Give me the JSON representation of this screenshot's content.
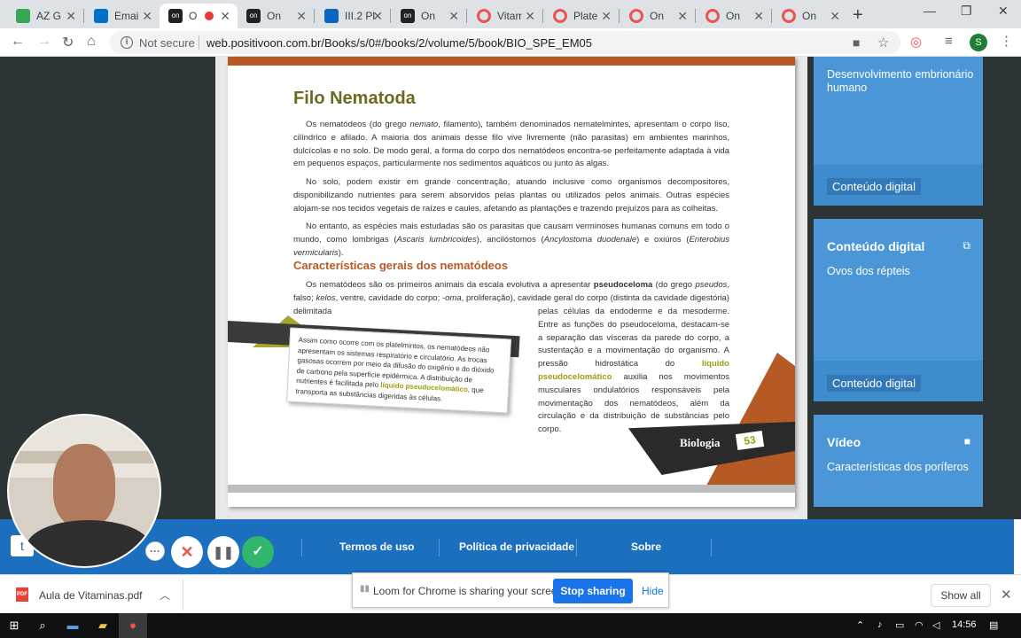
{
  "browser": {
    "tabs": [
      {
        "title": "AZ Gr",
        "favicon_color": "#34a853",
        "active": false
      },
      {
        "title": "Email",
        "favicon_color": "#0072c6",
        "active": false
      },
      {
        "title": "O",
        "favicon_color": "#222222",
        "active": true
      },
      {
        "title": "On",
        "favicon_color": "#222222",
        "active": false
      },
      {
        "title": "III.2 Pl",
        "favicon_color": "#0a66c2",
        "active": false
      },
      {
        "title": "On",
        "favicon_color": "#222222",
        "active": false
      },
      {
        "title": "Vitam",
        "favicon_color": "#e8554e",
        "active": false
      },
      {
        "title": "Platel",
        "favicon_color": "#e8554e",
        "active": false
      },
      {
        "title": "On",
        "favicon_color": "#e8554e",
        "active": false
      },
      {
        "title": "On",
        "favicon_color": "#e8554e",
        "active": false
      },
      {
        "title": "On",
        "favicon_color": "#e8554e",
        "active": false
      }
    ],
    "new_tab": "+",
    "not_secure": "Not secure",
    "url": "web.positivoon.com.br/Books/s/0#/books/2/volume/5/book/BIO_SPE_EM05",
    "profile_initial": "S"
  },
  "book": {
    "title": "Filo Nematoda",
    "para1_a": "Os nematódeos (do grego ",
    "para1_em": "nemato",
    "para1_b": ", filamento), também denominados nematelmintes, apresentam o corpo liso, cilíndrico e afilado. A maioria dos animais desse filo vive livremente (não parasitas) em ambientes marinhos, dulcícolas e no solo. De modo geral, a forma do corpo dos nematódeos encontra-se perfeitamente adaptada à vida em pequenos espaços, particularmente nos sedimentos aquáticos ou junto às algas.",
    "para2": "No solo, podem existir em grande concentração, atuando inclusive como organismos decompositores, disponibilizando nutrientes para serem absorvidos pelas plantas ou utilizados pelos animais. Outras espécies alojam-se nos tecidos vegetais de raízes e caules, afetando as plantações e trazendo prejuízos para as colheitas.",
    "para3_a": "No entanto, as espécies mais estudadas são os parasitas que causam verminoses humanas comuns em todo o mundo, como lombrigas (",
    "para3_em1": "Ascaris lumbricoides",
    "para3_b": "), ancilóstomos (",
    "para3_em2": "Ancylostoma duodenale",
    "para3_c": ") e oxiúros (",
    "para3_em3": "Enterobius vermicularis",
    "para3_d": ").",
    "section_heading": "Características gerais dos nematódeos",
    "para4_a": "Os nematódeos são os primeiros animais da escala evolutiva a apresentar ",
    "para4_strong": "pseudoceloma",
    "para4_b": " (do grego ",
    "para4_em1": "pseudos",
    "para4_c": ", falso; ",
    "para4_em2": "kelos",
    "para4_d": ", ventre, cavidade do corpo; ",
    "para4_em3": "-oma",
    "para4_e": ", proliferação), cavidade geral do corpo (distinta da cavidade digestória) delimitada",
    "para5_a": "pelas células da endoderme e da mesoderme. Entre as funções do pseudoceloma, destacam-se a separação das vísceras da parede do corpo, a sustentação e a movimentação do organismo. A pressão hidrostática do ",
    "para5_hl": "líquido pseudocelomático",
    "para5_b": " auxilia nos movimentos musculares ondulatórios responsáveis pela movimentação dos nematódeos, além da circulação e da distribuição de substâncias pelo corpo.",
    "callout_a": "Assim como ocorre com os platelmintos, os nematódeos não apresentam os sistemas respiratório e circulatório. As trocas gasosas ocorrem por meio da difusão do oxigênio e do dióxido de carbono pela superfície epidérmica. A distribuição de nutrientes é facilitada pelo ",
    "callout_hl": "líquido pseudocelomático",
    "callout_b": ", que transporta as substâncias digeridas às células.",
    "subject": "Biologia",
    "page_number": "53"
  },
  "sidebar": {
    "cards": [
      {
        "title": "",
        "subtitle": "Desenvolvimento embrionário humano",
        "link": "Conteúdo digital",
        "icon": ""
      },
      {
        "title": "Conteúdo digital",
        "subtitle": "Ovos dos répteis",
        "link": "Conteúdo digital",
        "icon": "link-icon"
      },
      {
        "title": "Vídeo",
        "subtitle": "Características dos poríferos",
        "link": "",
        "icon": "video-camera-icon"
      }
    ]
  },
  "footer": {
    "links": [
      "Termos de uso",
      "Política de privacidade",
      "Sobre"
    ]
  },
  "loom": {
    "share_message": "Loom for Chrome is sharing your screen.",
    "stop_label": "Stop sharing",
    "hide_label": "Hide"
  },
  "downloads": {
    "file_name": "Aula de Vitaminas.pdf",
    "file_type": "PDF",
    "show_all": "Show all"
  },
  "taskbar": {
    "time": "14:56"
  },
  "colors": {
    "accent_orange": "#b55a24",
    "olive": "#6b6b1f",
    "sidebar_blue": "#3f8ccd",
    "footer_blue": "#1b6fbe",
    "loom_blue": "#1a73e8"
  }
}
